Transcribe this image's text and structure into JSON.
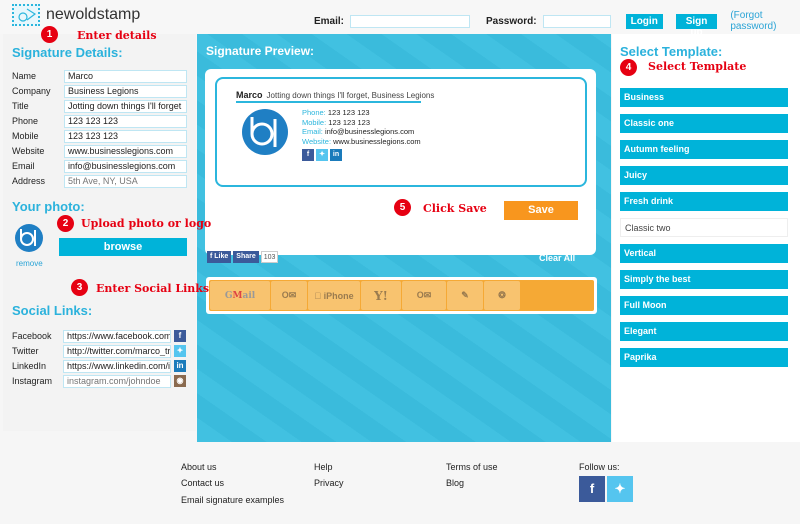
{
  "header": {
    "logo_text": "newoldstamp",
    "email_label": "Email:",
    "email_value": "",
    "password_label": "Password:",
    "password_value": "",
    "login_label": "Login",
    "signup_label": "Sign up",
    "forgot_label": "(Forgot password)"
  },
  "annotations": [
    {
      "num": "1",
      "text": "Enter details"
    },
    {
      "num": "2",
      "text": "Upload photo or logo"
    },
    {
      "num": "3",
      "text": "Enter Social Links"
    },
    {
      "num": "4",
      "text": "Select Template"
    },
    {
      "num": "5",
      "text": "Click Save"
    }
  ],
  "details": {
    "title": "Signature Details:",
    "fields": [
      {
        "label": "Name",
        "value": "Marco",
        "placeholder": ""
      },
      {
        "label": "Company",
        "value": "Business Legions",
        "placeholder": ""
      },
      {
        "label": "Title",
        "value": "Jotting down things I'll forget",
        "placeholder": ""
      },
      {
        "label": "Phone",
        "value": "123 123 123",
        "placeholder": ""
      },
      {
        "label": "Mobile",
        "value": "123 123 123",
        "placeholder": ""
      },
      {
        "label": "Website",
        "value": "www.businesslegions.com",
        "placeholder": ""
      },
      {
        "label": "Email",
        "value": "info@businesslegions.com",
        "placeholder": ""
      },
      {
        "label": "Address",
        "value": "",
        "placeholder": "5th Ave, NY, USA"
      }
    ]
  },
  "photo": {
    "title": "Your photo:",
    "remove_label": "remove",
    "browse_label": "browse"
  },
  "social": {
    "title": "Social Links:",
    "fields": [
      {
        "label": "Facebook",
        "value": "https://www.facebook.com/",
        "placeholder": "",
        "icon": "f",
        "color": "#3b5a9a"
      },
      {
        "label": "Twitter",
        "value": "http://twitter.com/marco_tra",
        "placeholder": "",
        "icon": "t",
        "color": "#55c5ef"
      },
      {
        "label": "LinkedIn",
        "value": "https://www.linkedin.com/ir",
        "placeholder": "",
        "icon": "in",
        "color": "#1a7bbb"
      },
      {
        "label": "Instagram",
        "value": "",
        "placeholder": "instagram.com/johndoe",
        "icon": "ig",
        "color": "#8a6a4f"
      }
    ]
  },
  "preview": {
    "title": "Signature Preview:",
    "name": "Marco",
    "tagline": "Jotting down things I'll forget, Business Legions",
    "lines": [
      {
        "key": "Phone:",
        "value": "123 123 123"
      },
      {
        "key": "Mobile:",
        "value": "123 123 123"
      },
      {
        "key": "Email:",
        "value": "info@businesslegions.com"
      },
      {
        "key": "Website:",
        "value": "www.businesslegions.com"
      }
    ],
    "social": [
      "f",
      "t",
      "in"
    ],
    "save_label": "Save",
    "like_label": "Like",
    "share_label": "Share",
    "share_count": "103",
    "clear_label": "Clear All",
    "clients": [
      "Gmail",
      "Outlook",
      "iPhone iPad",
      "Y!",
      "Outlook.com",
      "Apple Mail",
      "Thunderbird"
    ]
  },
  "templates": {
    "title": "Select Template:",
    "items": [
      {
        "label": "Business",
        "selected": false
      },
      {
        "label": "Classic one",
        "selected": false
      },
      {
        "label": "Autumn feeling",
        "selected": false
      },
      {
        "label": "Juicy",
        "selected": false
      },
      {
        "label": "Fresh drink",
        "selected": false
      },
      {
        "label": "Classic two",
        "selected": true
      },
      {
        "label": "Vertical",
        "selected": false
      },
      {
        "label": "Simply the best",
        "selected": false
      },
      {
        "label": "Full Moon",
        "selected": false
      },
      {
        "label": "Elegant",
        "selected": false
      },
      {
        "label": "Paprika",
        "selected": false
      }
    ]
  },
  "footer": {
    "col1": [
      "About us",
      "Contact us",
      "Email signature examples"
    ],
    "col2": [
      "Help",
      "Privacy"
    ],
    "col3": [
      "Terms of use",
      "Blog"
    ],
    "follow_label": "Follow us:"
  },
  "colors": {
    "accent": "#00b3d9",
    "save": "#f8961e",
    "annotation": "#e60012"
  }
}
